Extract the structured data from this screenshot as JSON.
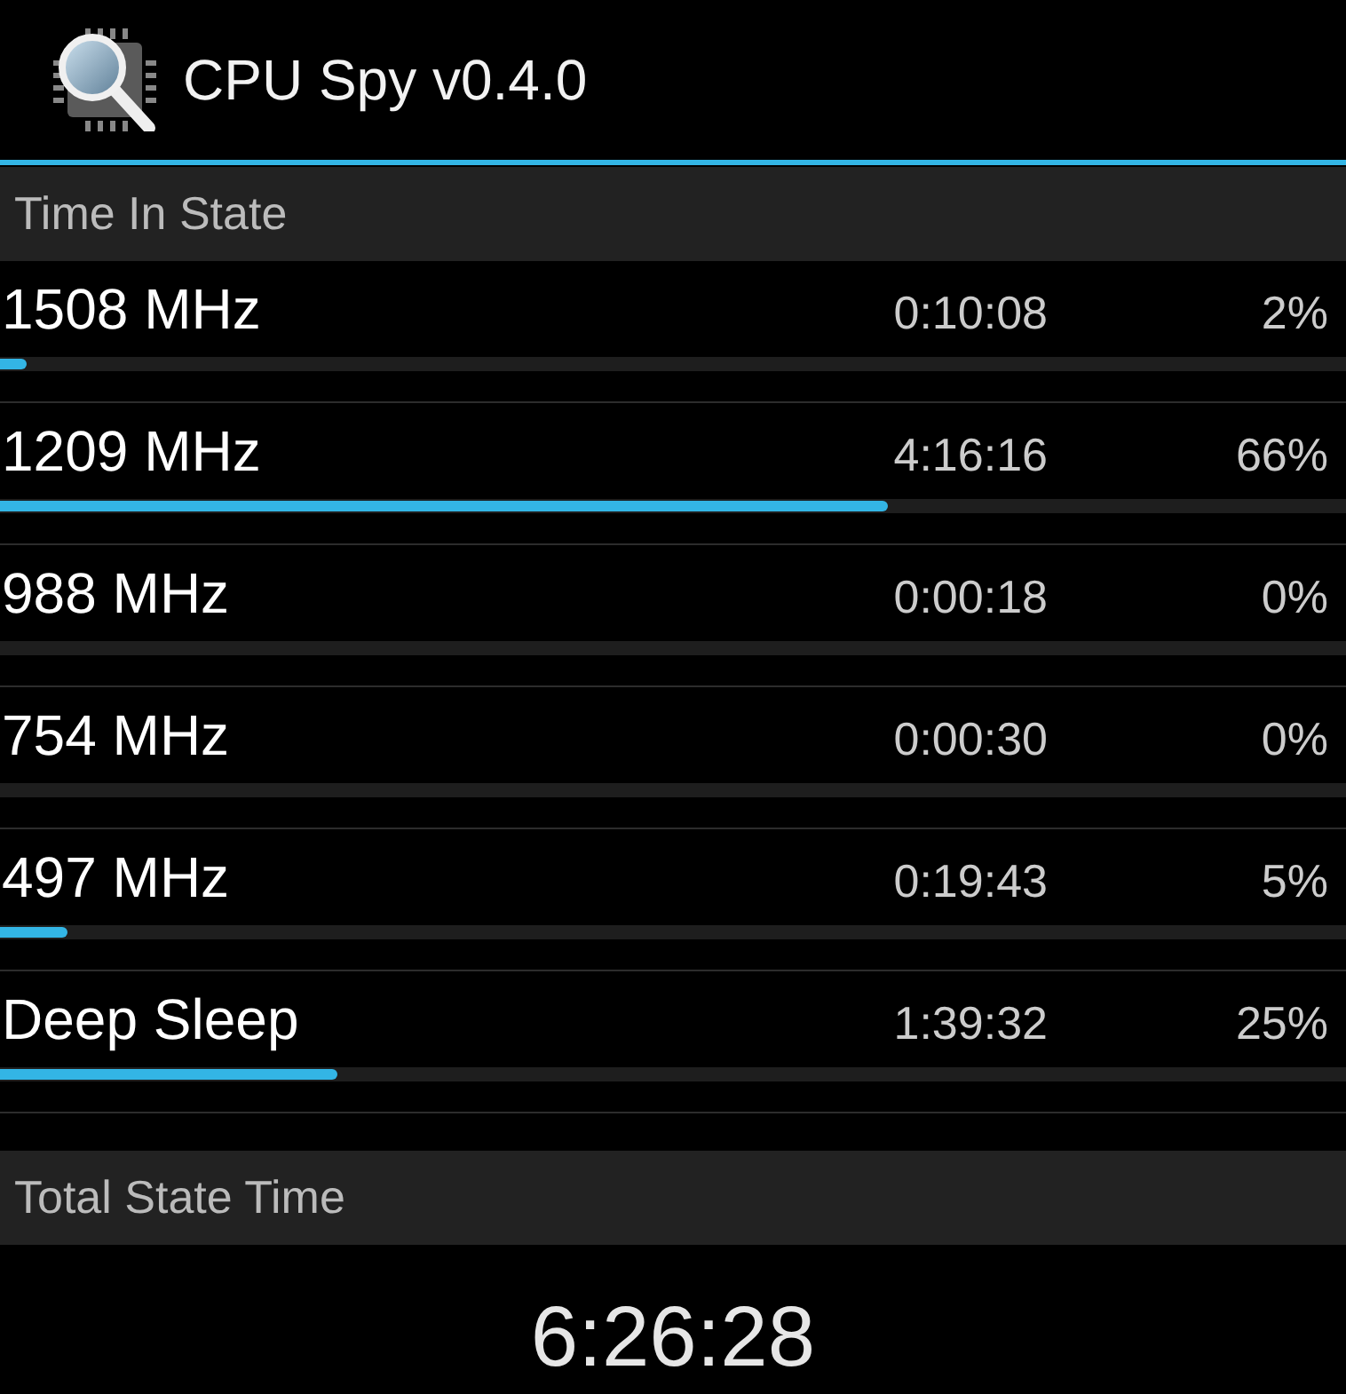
{
  "action_bar": {
    "title": "CPU Spy v0.4.0"
  },
  "time_in_state": {
    "header": "Time In State",
    "states": [
      {
        "name": "1508 MHz",
        "time": "0:10:08",
        "percent": "2%",
        "level": 0.02
      },
      {
        "name": "1209 MHz",
        "time": "4:16:16",
        "percent": "66%",
        "level": 0.66
      },
      {
        "name": "988 MHz",
        "time": "0:00:18",
        "percent": "0%"
      },
      {
        "name": "754 MHz",
        "time": "0:00:30",
        "percent": "0%"
      },
      {
        "name": "497 MHz",
        "time": "0:19:43",
        "percent": "5%",
        "level": 0.05
      },
      {
        "name": "Deep Sleep",
        "time": "1:39:32",
        "percent": "25%",
        "level": 0.25
      }
    ]
  },
  "total_state_time": {
    "header": "Total State Time",
    "value": "6:26:28"
  }
}
